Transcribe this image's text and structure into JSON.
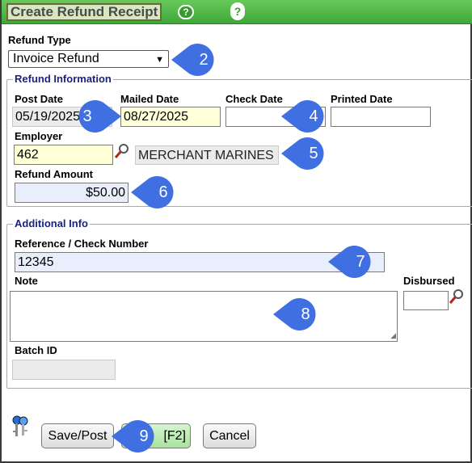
{
  "title": "Create Refund Receipt",
  "help_icon": "question-mark-circle-icon",
  "refund_type": {
    "label": "Refund Type",
    "value": "Invoice Refund"
  },
  "refund_info": {
    "legend": "Refund Information",
    "post_date": {
      "label": "Post Date",
      "value": "05/19/2025"
    },
    "mailed_date": {
      "label": "Mailed Date",
      "value": "08/27/2025"
    },
    "check_date": {
      "label": "Check Date",
      "value": ""
    },
    "printed_date": {
      "label": "Printed Date",
      "value": ""
    },
    "employer": {
      "label": "Employer",
      "value": "462",
      "name": "MERCHANT MARINES"
    },
    "refund_amount": {
      "label": "Refund Amount",
      "value": "$50.00"
    }
  },
  "additional_info": {
    "legend": "Additional Info",
    "reference": {
      "label": "Reference / Check Number",
      "value": "12345"
    },
    "note": {
      "label": "Note",
      "value": ""
    },
    "disbursed": {
      "label": "Disbursed",
      "value": ""
    },
    "batch_id": {
      "label": "Batch ID",
      "value": ""
    }
  },
  "buttons": {
    "save_post": "Save/Post",
    "f2": "[F2]",
    "cancel": "Cancel"
  },
  "callouts": [
    "2",
    "3",
    "4",
    "5",
    "6",
    "7",
    "8",
    "9"
  ],
  "colors": {
    "title_bar": "#4caf50",
    "callout": "#3f6fe0",
    "required_field": "#ffffd8",
    "highlight_field": "#e8eefb"
  }
}
